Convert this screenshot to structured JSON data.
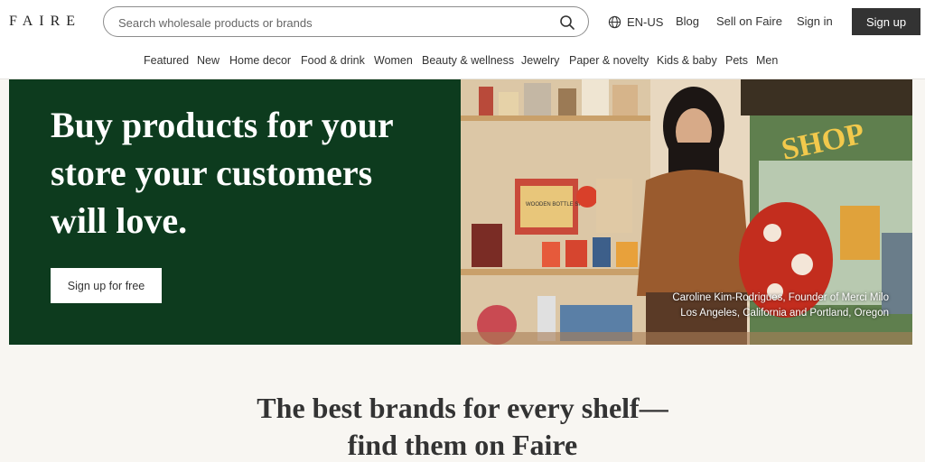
{
  "header": {
    "logo": "FAIRE",
    "search_placeholder": "Search wholesale products or brands",
    "language": "EN-US",
    "links": [
      "Blog",
      "Sell on Faire",
      "Sign in"
    ],
    "signup": "Sign up"
  },
  "categories": [
    "Featured",
    "New",
    "Home decor",
    "Food & drink",
    "Women",
    "Beauty & wellness",
    "Jewelry",
    "Paper & novelty",
    "Kids & baby",
    "Pets",
    "Men"
  ],
  "hero": {
    "title_lines": [
      "Buy products for your",
      "store your customers",
      "will love."
    ],
    "cta": "Sign up for free",
    "caption_name": "Caroline Kim-Rodrigues, Founder of Merci Milo",
    "caption_location": "Los Angeles, California and Portland, Oregon",
    "photo_sign_text": "SHOP",
    "box_label": "WOODEN BOTTLE SHIP"
  },
  "section": {
    "title_line1": "The best brands for every shelf—",
    "title_line2": "find them on Faire"
  },
  "colors": {
    "hero_bg": "#0d3b1e",
    "button_dark": "#333333",
    "page_bg": "#f8f6f2"
  }
}
